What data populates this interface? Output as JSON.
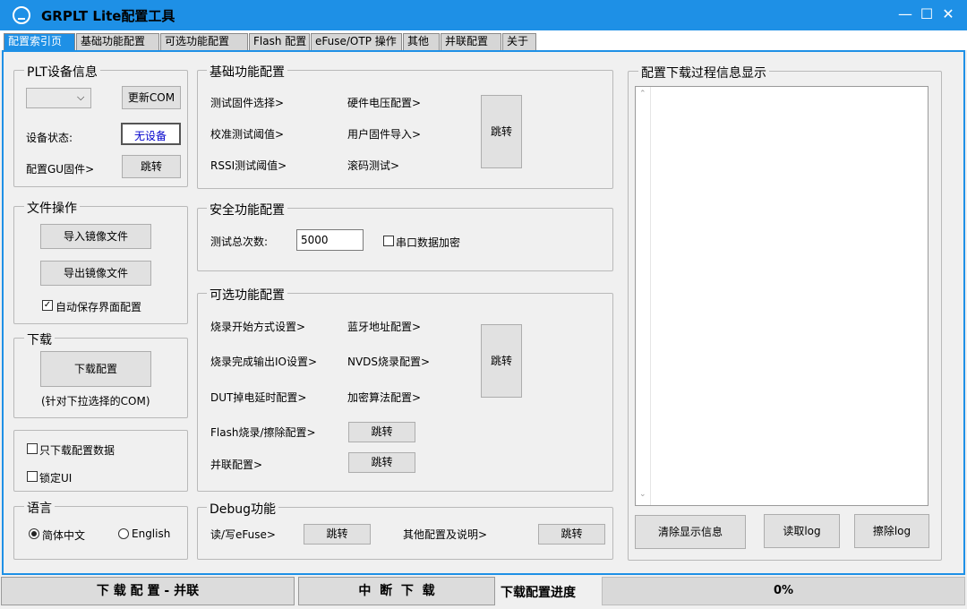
{
  "window": {
    "title": "GRPLT Lite配置工具",
    "minimize": "—",
    "maximize": "☐",
    "close": "✕"
  },
  "tabs": [
    "配置索引页",
    "基础功能配置",
    "可选功能配置",
    "Flash 配置",
    "eFuse/OTP 操作",
    "其他",
    "并联配置",
    "关于"
  ],
  "plt": {
    "title": "PLT设备信息",
    "com_value": "",
    "refresh_label": "更新COM",
    "status_label": "设备状态:",
    "status_value": "无设备",
    "status_color": "#0000cc",
    "gu_label": "配置GU固件>",
    "gu_button": "跳转"
  },
  "file": {
    "title": "文件操作",
    "import_label": "导入镜像文件",
    "export_label": "导出镜像文件",
    "autosave_label": "自动保存界面配置",
    "autosave_checked": true
  },
  "download": {
    "title": "下载",
    "button": "下载配置",
    "note": "(针对下拉选择的COM)"
  },
  "options": {
    "only_download_label": "只下载配置数据",
    "only_download_checked": false,
    "lock_ui_label": "锁定UI",
    "lock_ui_checked": false
  },
  "language": {
    "title": "语言",
    "zh_label": "简体中文",
    "en_label": "English",
    "selected": "简体中文"
  },
  "basic": {
    "title": "基础功能配置",
    "items": [
      "测试固件选择>",
      "硬件电压配置>",
      "校准测试阈值>",
      "用户固件导入>",
      "RSSI测试阈值>",
      "滚码测试>"
    ],
    "jump": "跳转"
  },
  "security": {
    "title": "安全功能配置",
    "count_label": "测试总次数:",
    "count_value": "5000",
    "encrypt_label": "串口数据加密",
    "encrypt_checked": false
  },
  "optional": {
    "title": "可选功能配置",
    "items": [
      "烧录开始方式设置>",
      "蓝牙地址配置>",
      "烧录完成输出IO设置>",
      "NVDS烧录配置>",
      "DUT掉电延时配置>",
      "加密算法配置>"
    ],
    "jump": "跳转",
    "flash_label": "Flash烧录/擦除配置>",
    "flash_jump": "跳转",
    "parallel_label": "并联配置>",
    "parallel_jump": "跳转"
  },
  "debug": {
    "title": "Debug功能",
    "efuse_label": "读/写eFuse>",
    "efuse_jump": "跳转",
    "other_label": "其他配置及说明>",
    "other_jump": "跳转"
  },
  "log": {
    "title": "配置下载过程信息显示",
    "text": "",
    "clear": "清除显示信息",
    "read": "读取log",
    "erase": "擦除log"
  },
  "statusbar": {
    "download_parallel": "下 载 配 置 - 并联",
    "interrupt": "中  断  下  载",
    "progress_label": "下载配置进度",
    "progress_value": "0%",
    "progress_fraction": 0
  }
}
